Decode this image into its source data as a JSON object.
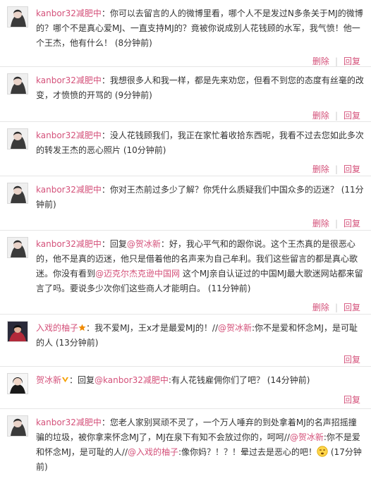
{
  "comments": [
    {
      "author": "kanbor32减肥中",
      "parts": [
        "：你可以去留言的人的微博里看，哪个人不是发过N多条关于MJ的微博的？哪个不是真心爱MJ、一直支持MJ的？竟被你说成别人花钱顾的水军，我气愤！他一个王杰，他有什么！ (8分钟前)"
      ],
      "delete_label": "删除",
      "reply_label": "回复"
    },
    {
      "author": "kanbor32减肥中",
      "parts": [
        "：我想很多人和我一样，都是先来劝您，但看不到您的态度有丝毫的改变，才愤愤的开骂的 (9分钟前)"
      ],
      "delete_label": "删除",
      "reply_label": "回复"
    },
    {
      "author": "kanbor32减肥中",
      "parts": [
        "：没人花钱顾我们，我正在家忙着收拾东西呢，我看不过去您如此多次的转发王杰的恶心照片 (10分钟前)"
      ],
      "delete_label": "删除",
      "reply_label": "回复"
    },
    {
      "author": "kanbor32减肥中",
      "parts": [
        "：你对王杰前过多少了解？你凭什么质疑我们中国众多的迈迷？ (11分钟前)"
      ],
      "delete_label": "删除",
      "reply_label": "回复"
    },
    {
      "author": "kanbor32减肥中",
      "parts": [
        "：回复",
        "@贺冰新",
        "：好，我心平气和的跟你说。这个王杰真的是很恶心的，他不是真的迈迷，他只是借着他的名声来为自己牟利。我们这些留言的都是真心歌迷。你没有看到",
        "@迈克尔杰克逊中国网",
        " 这个MJ亲自认证过的中国MJ最大歌迷网站都来留言了吗。要说多少次你们这些商人才能明白。 (11分钟前)"
      ],
      "delete_label": "删除",
      "reply_label": "回复"
    },
    {
      "author": "入戏的柚子",
      "parts": [
        "：我不爱MJ，王x才是最爱MJ的！//",
        "@贺冰新",
        ":你不是爱和怀念MJ，是可耻的人 (13分钟前)"
      ],
      "reply_label": "回复"
    },
    {
      "author": "贺冰新",
      "parts": [
        "：回复",
        "@kanbor32减肥中",
        ":有人花钱雇佣你们了吧？ (14分钟前)"
      ],
      "reply_label": "回复"
    },
    {
      "author": "kanbor32减肥中",
      "parts": [
        "：您老人家别冥顽不灵了，一个万人唾弃的到处拿着MJ的名声招摇撞骗的垃圾，被你拿来怀念MJ了，MJ在泉下有知不会放过你的，呵呵//",
        "@贺冰新",
        ":你不是爱和怀念MJ，是可耻的人",
        "//",
        "@入戏的柚子",
        ":像你妈？！？！晕过去是恶心的吧！",
        " (17分钟前)"
      ]
    }
  ],
  "colors": {
    "accent": "#d4517a",
    "text": "#333333",
    "divider": "#e6e6e6"
  }
}
